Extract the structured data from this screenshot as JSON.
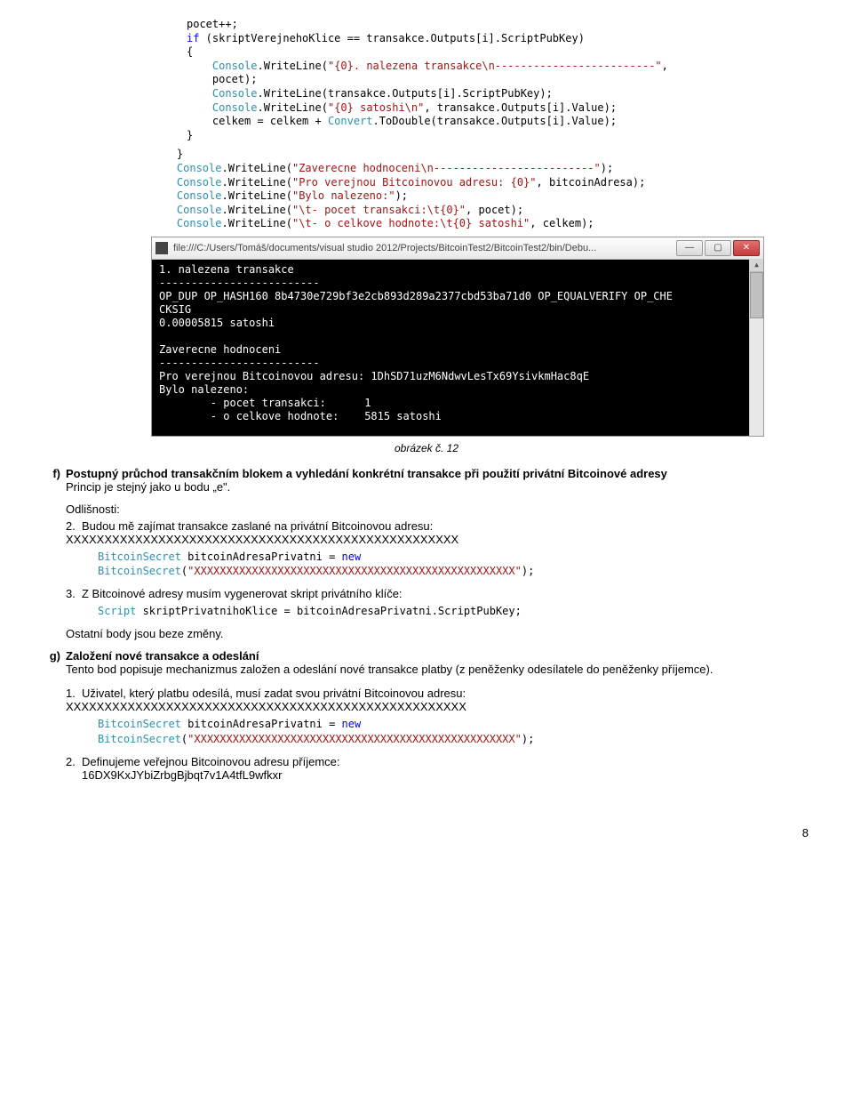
{
  "code1": {
    "l1a": "pocet++;",
    "l2a": "if",
    "l2b": " (skriptVerejnehoKlice == transakce.Outputs[i].ScriptPubKey)",
    "l3": "{",
    "l4a": "    ",
    "l4b": "Console",
    "l4c": ".WriteLine(",
    "l4d": "\"{0}. nalezena transakce\\n-------------------------\"",
    "l4e": ", ",
    "l5": "    pocet);",
    "l6a": "    ",
    "l6b": "Console",
    "l6c": ".WriteLine(transakce.Outputs[i].ScriptPubKey);",
    "l7a": "    ",
    "l7b": "Console",
    "l7c": ".WriteLine(",
    "l7d": "\"{0} satoshi\\n\"",
    "l7e": ", transakce.Outputs[i].Value);",
    "l8a": "    celkem = celkem + ",
    "l8b": "Convert",
    "l8c": ".ToDouble(transakce.Outputs[i].Value);",
    "l9": "}",
    "r1": "}",
    "r2a": "Console",
    "r2b": ".WriteLine(",
    "r2c": "\"Zaverecne hodnoceni\\n-------------------------\"",
    "r2d": ");",
    "r3a": "Console",
    "r3b": ".WriteLine(",
    "r3c": "\"Pro verejnou Bitcoinovou adresu: {0}\"",
    "r3d": ", bitcoinAdresa);",
    "r4a": "Console",
    "r4b": ".WriteLine(",
    "r4c": "\"Bylo nalezeno:\"",
    "r4d": ");",
    "r5a": "Console",
    "r5b": ".WriteLine(",
    "r5c": "\"\\t- pocet transakci:\\t{0}\"",
    "r5d": ", pocet);",
    "r6a": "Console",
    "r6b": ".WriteLine(",
    "r6c": "\"\\t- o celkove hodnote:\\t{0} satoshi\"",
    "r6d": ", celkem);"
  },
  "console": {
    "title": "file:///C:/Users/Tomáš/documents/visual studio 2012/Projects/BitcoinTest2/BitcoinTest2/bin/Debu...",
    "body": "1. nalezena transakce\n-------------------------\nOP_DUP OP_HASH160 8b4730e729bf3e2cb893d289a2377cbd53ba71d0 OP_EQUALVERIFY OP_CHE\nCKSIG\n0.00005815 satoshi\n\nZaverecne hodnoceni\n-------------------------\nPro verejnou Bitcoinovou adresu: 1DhSD71uzM6NdwvLesTx69YsivkmHac8qE\nBylo nalezeno:\n        - pocet transakci:      1\n        - o celkove hodnote:    5815 satoshi"
  },
  "caption": "obrázek č. 12",
  "f": {
    "letter": "f)",
    "heading": "Postupný průchod transakčním blokem a vyhledání konkrétní transakce při použití privátní Bitcoinové adresy",
    "line1": "Princip je stejný jako u bodu „e\".",
    "odl": "Odlišnosti:",
    "n2a": "2.",
    "n2b": "Budou mě zajímat transakce zaslané na privátní Bitcoinovou adresu: XXXXXXXXXXXXXXXXXXXXXXXXXXXXXXXXXXXXXXXXXXXXXXXXXXX",
    "code2a": "BitcoinSecret",
    "code2b": " bitcoinAdresaPrivatni = ",
    "code2c": "new",
    "code2d": "BitcoinSecret",
    "code2e": "(",
    "code2f": "\"XXXXXXXXXXXXXXXXXXXXXXXXXXXXXXXXXXXXXXXXXXXXXXXXXX\"",
    "code2g": ");",
    "n3a": "3.",
    "n3b": "Z Bitcoinové adresy musím vygenerovat skript privátního klíče:",
    "code3a": "Script",
    "code3b": " skriptPrivatnihoKlice = bitcoinAdresaPrivatni.ScriptPubKey;",
    "rest": "Ostatní body jsou beze změny."
  },
  "g": {
    "letter": "g)",
    "heading": "Založení nové transakce a odeslání",
    "line1": "Tento bod popisuje mechanizmus založen a odeslání nové transakce platby (z peněženky odesílatele do peněženky příjemce).",
    "n1a": "1.",
    "n1b": "Uživatel, který platbu odesílá, musí zadat svou privátní Bitcoinovou adresu: XXXXXXXXXXXXXXXXXXXXXXXXXXXXXXXXXXXXXXXXXXXXXXXXXXXX",
    "code1a": "BitcoinSecret",
    "code1b": " bitcoinAdresaPrivatni = ",
    "code1c": "new",
    "code1d": "BitcoinSecret",
    "code1e": "(",
    "code1f": "\"XXXXXXXXXXXXXXXXXXXXXXXXXXXXXXXXXXXXXXXXXXXXXXXXXX\"",
    "code1g": ");",
    "n2a": "2.",
    "n2b": "Definujeme veřejnou Bitcoinovou adresu příjemce:",
    "n2c": "16DX9KxJYbiZrbgBjbqt7v1A4tfL9wfkxr"
  },
  "pagenum": "8"
}
